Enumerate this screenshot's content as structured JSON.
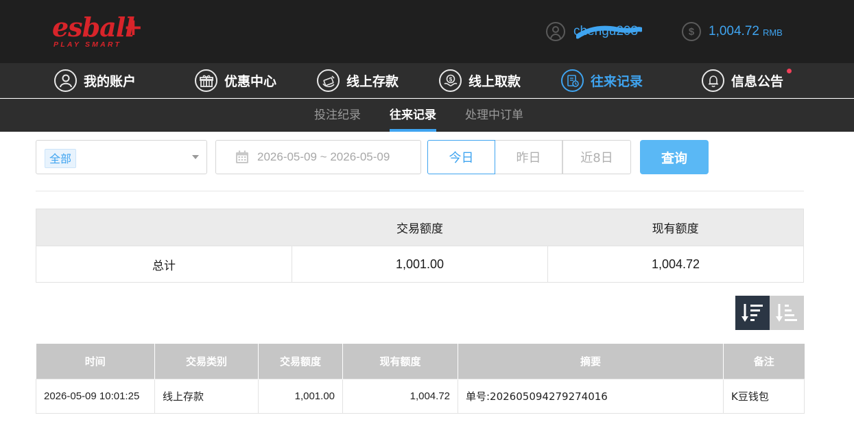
{
  "brand": {
    "logo_text": "esball",
    "logo_plus": "+",
    "logo_tagline": "PLAY SMART",
    "accent": "#3fa4f0",
    "logo_color": "#d8242a"
  },
  "header": {
    "username": "chengu203",
    "balance": "1,004.72",
    "currency": "RMB",
    "user_icon": "user-icon",
    "balance_icon": "dollar-coin-icon"
  },
  "mainnav": {
    "items": [
      {
        "label": "我的账户",
        "icon": "user-icon",
        "active": false
      },
      {
        "label": "优惠中心",
        "icon": "gift-icon",
        "active": false
      },
      {
        "label": "线上存款",
        "icon": "deposit-icon",
        "active": false
      },
      {
        "label": "线上取款",
        "icon": "withdraw-icon",
        "active": false
      },
      {
        "label": "往来记录",
        "icon": "records-icon",
        "active": true
      },
      {
        "label": "信息公告",
        "icon": "bell-icon",
        "active": false,
        "notification": true
      }
    ]
  },
  "subnav": {
    "items": [
      {
        "label": "投注纪录",
        "active": false
      },
      {
        "label": "往来记录",
        "active": true
      },
      {
        "label": "处理中订单",
        "active": false
      }
    ]
  },
  "filters": {
    "type_value": "全部",
    "date_range": "2026-05-09 ~ 2026-05-09",
    "quick": [
      "今日",
      "昨日",
      "近8日"
    ],
    "query_label": "查询"
  },
  "summary": {
    "headers": [
      "",
      "交易额度",
      "现有额度"
    ],
    "row": {
      "label": "总计",
      "amount": "1,001.00",
      "balance": "1,004.72"
    }
  },
  "records": {
    "headers": [
      "时间",
      "交易类别",
      "交易额度",
      "现有额度",
      "摘要",
      "备注"
    ],
    "rows": [
      {
        "time": "2026-05-09 10:01:25",
        "type": "线上存款",
        "amount": "1,001.00",
        "balance": "1,004.72",
        "summary": "单号:202605094279274016",
        "remark": "K豆钱包"
      }
    ]
  }
}
